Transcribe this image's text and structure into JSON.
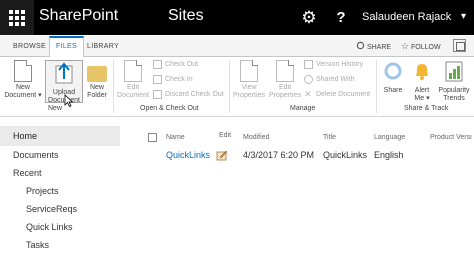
{
  "suite_bar": {
    "brand": "SharePoint",
    "section": "Sites",
    "user_name": "Salaudeen Rajack",
    "user_caret": "▾"
  },
  "tabs": {
    "browse": "BROWSE",
    "files": "FILES",
    "library": "LIBRARY",
    "share": "SHARE",
    "follow": "FOLLOW"
  },
  "ribbon": {
    "new_group": {
      "label": "New",
      "new_document": [
        "New",
        "Document ▾"
      ],
      "upload_document": [
        "Upload",
        "Document"
      ],
      "new_folder": [
        "New",
        "Folder"
      ]
    },
    "open_checkout_group": {
      "label": "Open & Check Out",
      "edit_document": [
        "Edit",
        "Document"
      ],
      "check_out": "Check Out",
      "check_in": "Check In",
      "discard_check_out": "Discard Check Out"
    },
    "manage_group": {
      "label": "Manage",
      "view_properties": [
        "View",
        "Properties"
      ],
      "edit_properties": [
        "Edit",
        "Properties"
      ],
      "version_history": "Version History",
      "shared_with": "Shared With",
      "delete_document": "Delete Document"
    },
    "share_track_group": {
      "label": "Share & Track",
      "share": "Share",
      "alert_me": [
        "Alert",
        "Me ▾"
      ],
      "popularity_trends": [
        "Popularity",
        "Trends"
      ]
    }
  },
  "nav": {
    "home": "Home",
    "documents": "Documents",
    "recent": "Recent",
    "recent_items": [
      "Projects",
      "ServiceReqs",
      "Quick Links",
      "Tasks"
    ]
  },
  "list": {
    "columns": {
      "name": "Name",
      "edit": "Edit",
      "modified": "Modified",
      "title": "Title",
      "language": "Language",
      "product_version": "Product Versi"
    },
    "rows": [
      {
        "name": "QuickLinks",
        "modified": "4/3/2017 6:20 PM",
        "title": "QuickLinks",
        "language": "English"
      }
    ]
  },
  "colors": {
    "accent": "#0072c6",
    "suite_bar": "#000000",
    "nav_selected": "#eaeaea"
  }
}
